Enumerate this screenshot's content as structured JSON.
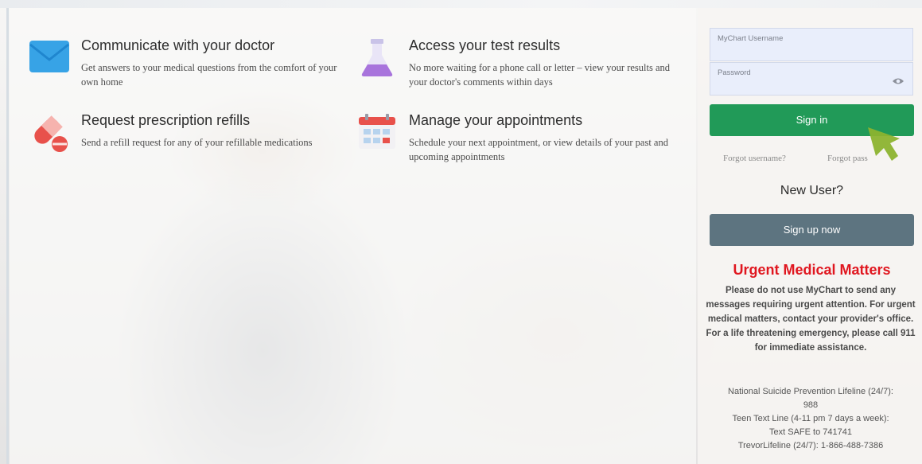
{
  "features": [
    {
      "title": "Communicate with your doctor",
      "desc": "Get answers to your medical questions from the comfort of your own home",
      "icon": "envelope-icon"
    },
    {
      "title": "Access your test results",
      "desc": "No more waiting for a phone call or letter – view your results and your doctor's comments within days",
      "icon": "flask-icon"
    },
    {
      "title": "Request prescription refills",
      "desc": "Send a refill request for any of your refillable medications",
      "icon": "pill-icon"
    },
    {
      "title": "Manage your appointments",
      "desc": "Schedule your next appointment, or view details of your past and upcoming appointments",
      "icon": "calendar-icon"
    }
  ],
  "login": {
    "username_placeholder": "MyChart Username",
    "password_placeholder": "Password",
    "signin_label": "Sign in",
    "forgot_username": "Forgot username?",
    "forgot_password": "Forgot pass",
    "new_user": "New User?",
    "signup_label": "Sign up now"
  },
  "urgent": {
    "title": "Urgent Medical Matters",
    "body": "Please do not use MyChart to send any messages requiring urgent attention. For urgent medical matters, contact your provider's office. For a life threatening emergency, please call 911 for immediate assistance.",
    "lines": [
      "National Suicide Prevention Lifeline (24/7):",
      "988",
      "Teen Text Line (4-11 pm 7 days a week):",
      "Text SAFE to 741741",
      "TrevorLifeline (24/7): 1-866-488-7386"
    ]
  },
  "colors": {
    "signin": "#219a58",
    "signup": "#5d7480",
    "urgent": "#e0161f",
    "envelope": "#37a3e6"
  }
}
